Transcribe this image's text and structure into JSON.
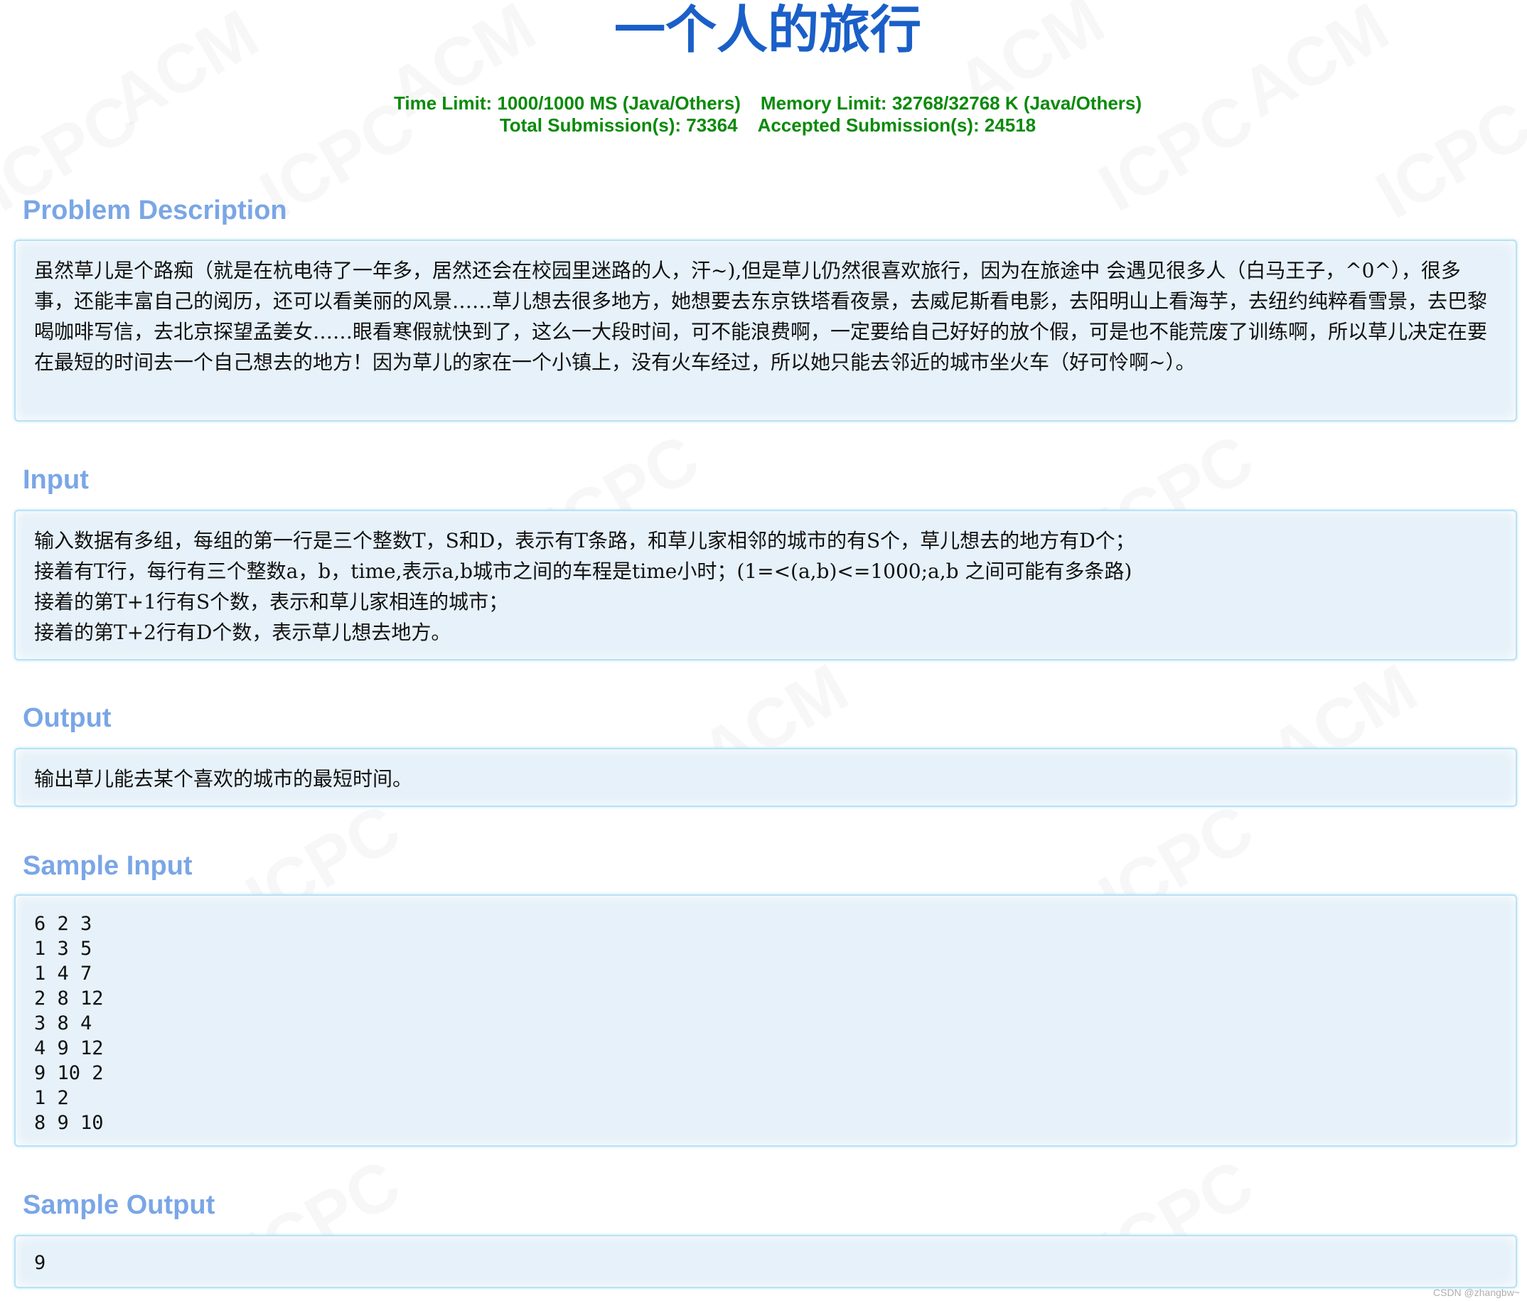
{
  "problem": {
    "title": "一个人的旅行",
    "time_limit": "Time Limit: 1000/1000 MS (Java/Others)",
    "memory_limit": "Memory Limit: 32768/32768 K (Java/Others)",
    "total_submissions": "Total Submission(s): 73364",
    "accepted_submissions": "Accepted Submission(s): 24518"
  },
  "sections": {
    "description": {
      "title": "Problem Description",
      "body": "虽然草儿是个路痴（就是在杭电待了一年多，居然还会在校园里迷路的人，汗~),但是草儿仍然很喜欢旅行，因为在旅途中 会遇见很多人（白马王子，^0^），很多事，还能丰富自己的阅历，还可以看美丽的风景……草儿想去很多地方，她想要去东京铁塔看夜景，去威尼斯看电影，去阳明山上看海芋，去纽约纯粹看雪景，去巴黎喝咖啡写信，去北京探望孟姜女……眼看寒假就快到了，这么一大段时间，可不能浪费啊，一定要给自己好好的放个假，可是也不能荒废了训练啊，所以草儿决定在要在最短的时间去一个自己想去的地方！因为草儿的家在一个小镇上，没有火车经过，所以她只能去邻近的城市坐火车（好可怜啊~）。"
    },
    "input": {
      "title": "Input",
      "body": "输入数据有多组，每组的第一行是三个整数T，S和D，表示有T条路，和草儿家相邻的城市的有S个，草儿想去的地方有D个；\n接着有T行，每行有三个整数a，b，time,表示a,b城市之间的车程是time小时；(1=<(a,b)<=1000;a,b 之间可能有多条路)\n接着的第T+1行有S个数，表示和草儿家相连的城市；\n接着的第T+2行有D个数，表示草儿想去地方。"
    },
    "output": {
      "title": "Output",
      "body": "输出草儿能去某个喜欢的城市的最短时间。"
    },
    "sample_input": {
      "title": "Sample Input",
      "body": "6 2 3\n1 3 5\n1 4 7\n2 8 12\n3 8 4\n4 9 12\n9 10 2\n1 2\n8 9 10"
    },
    "sample_output": {
      "title": "Sample Output",
      "body": "9"
    }
  },
  "watermark": {
    "text_acm": "ACM",
    "text_icpc": "ICPC",
    "credit": "CSDN @zhangbw~"
  }
}
